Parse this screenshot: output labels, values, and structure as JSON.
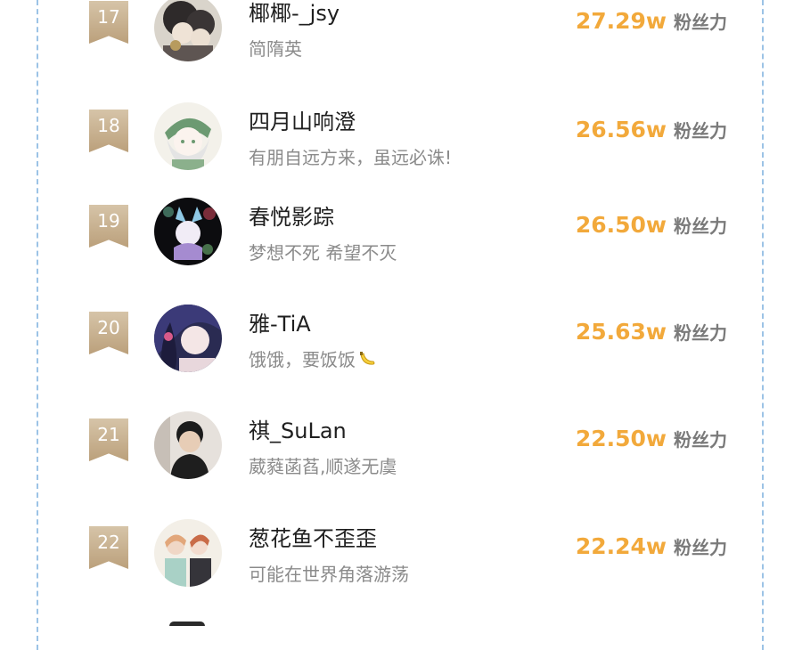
{
  "fans_label": "粉丝力",
  "accent_color": "#f2a93b",
  "rows": [
    {
      "rank": "17",
      "name": "椰椰-_jsy",
      "signature": "简隋英",
      "fans": "27.29w",
      "avatar": "avatar-icon"
    },
    {
      "rank": "18",
      "name": "四月山响澄",
      "signature": "有朋自远方来，虽远必诛!",
      "fans": "26.56w",
      "avatar": "avatar-icon"
    },
    {
      "rank": "19",
      "name": "春悦影踪",
      "signature": "梦想不死  希望不灭",
      "fans": "26.50w",
      "avatar": "avatar-icon"
    },
    {
      "rank": "20",
      "name": "雅-TiA",
      "signature": "饿饿，要饭饭",
      "fans": "25.63w",
      "avatar": "avatar-icon",
      "emoji": "banana-icon"
    },
    {
      "rank": "21",
      "name": "祺_SuLan",
      "signature": "葳蕤菡萏,顺遂无虞",
      "fans": "22.50w",
      "avatar": "avatar-icon"
    },
    {
      "rank": "22",
      "name": "葱花鱼不歪歪",
      "signature": "可能在世界角落游荡",
      "fans": "22.24w",
      "avatar": "avatar-icon"
    }
  ]
}
